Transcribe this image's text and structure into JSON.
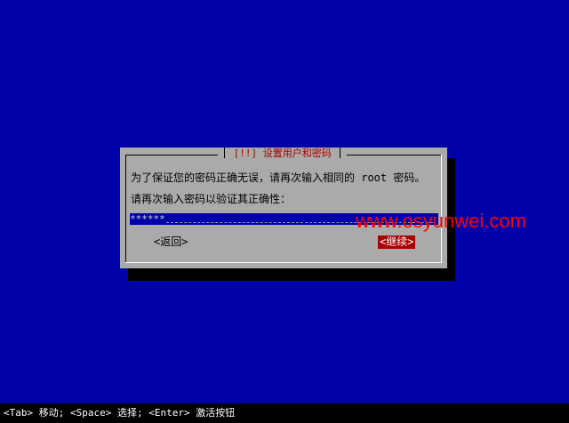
{
  "dialog": {
    "title_marker": "[!!]",
    "title": "设置用户和密码",
    "message": "为了保证您的密码正确无误，请再次输入相同的 root 密码。",
    "prompt": "请再次输入密码以验证其正确性：",
    "password_value": "******",
    "back_button": "<返回>",
    "continue_button": "<继续>"
  },
  "watermark": "www.osyunwei.com",
  "statusbar": {
    "help": "<Tab> 移动; <Space> 选择; <Enter> 激活按钮"
  },
  "colors": {
    "background": "#0000a8",
    "dialog": "#aaaaaa",
    "shadow": "#000000",
    "title": "#a80000",
    "selected_button": "#a80000",
    "watermark": "#ff0000"
  }
}
